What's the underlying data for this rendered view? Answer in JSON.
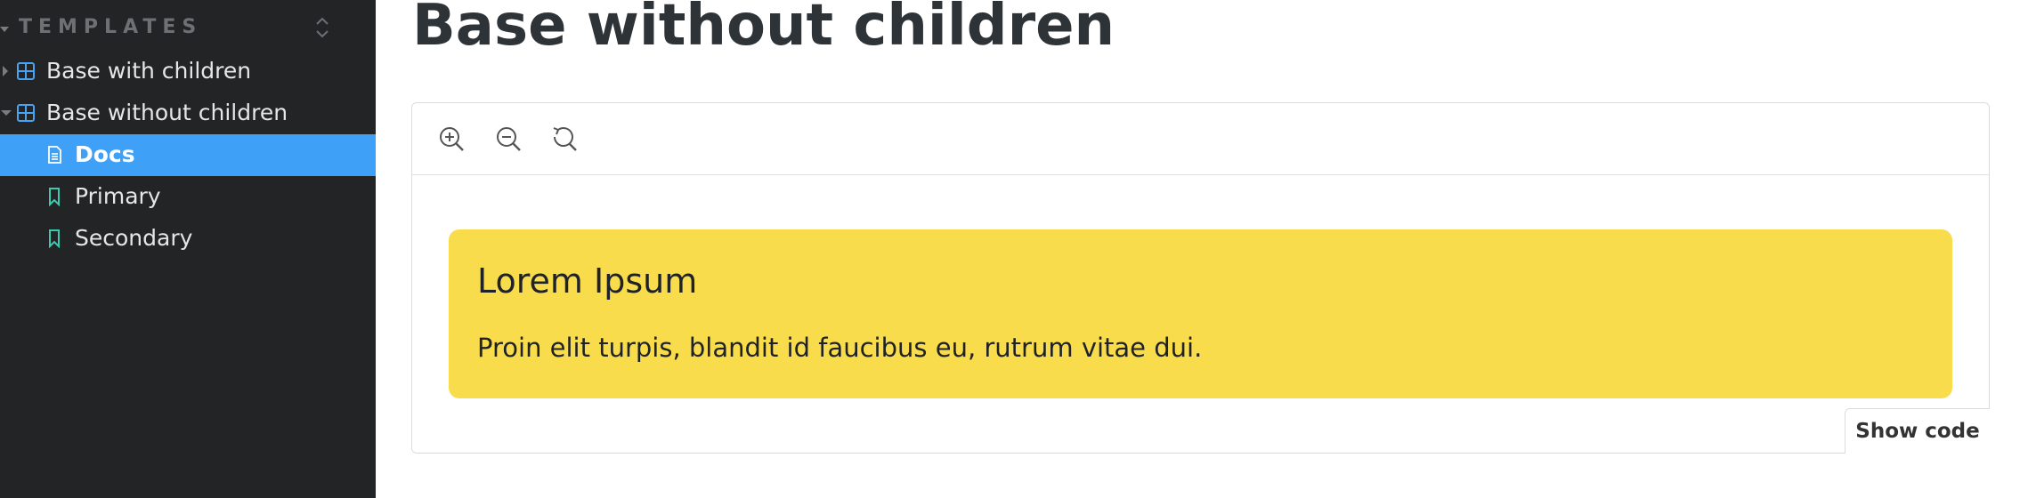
{
  "sidebar": {
    "section_title": "TEMPLATES",
    "items": [
      {
        "label": "Base with children",
        "icon": "component-icon",
        "state": "collapsed"
      },
      {
        "label": "Base without children",
        "icon": "component-icon",
        "state": "expanded"
      },
      {
        "label": "Docs",
        "icon": "document-icon",
        "state": "selected"
      },
      {
        "label": "Primary",
        "icon": "bookmark-icon"
      },
      {
        "label": "Secondary",
        "icon": "bookmark-icon"
      }
    ]
  },
  "main": {
    "title": "Base without children",
    "toolbar": {
      "zoom_in": "zoom-in-icon",
      "zoom_out": "zoom-out-icon",
      "reset": "reset-zoom-icon"
    },
    "card": {
      "title": "Lorem Ipsum",
      "text": "Proin elit turpis, blandit id faucibus eu, rutrum vitae dui.",
      "background": "#f8dc4b"
    },
    "show_code_label": "Show code"
  },
  "colors": {
    "sidebar_bg": "#222425",
    "selected_bg": "#3fa0f8",
    "component_icon": "#4aa3f0",
    "bookmark_icon": "#3cc9b0"
  }
}
